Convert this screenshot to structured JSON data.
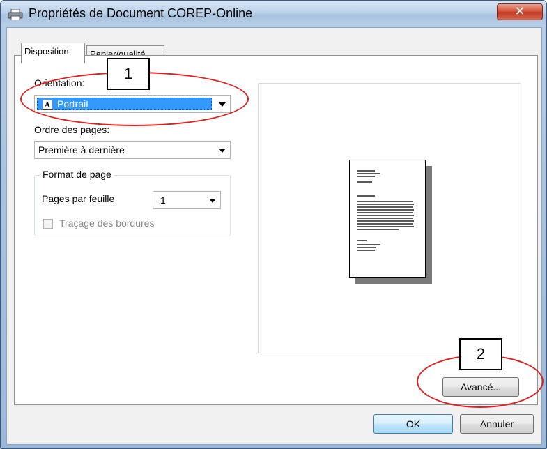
{
  "window": {
    "title": "Propriétés de Document COREP-Online",
    "close_icon": "close-x-icon",
    "title_icon": "printer-icon"
  },
  "tabs": [
    {
      "label": "Disposition",
      "active": true
    },
    {
      "label": "Papier/qualité",
      "active": false
    }
  ],
  "layout": {
    "orientation_label": "Orientation:",
    "orientation_value": "Portrait",
    "orientation_icon": "portrait-A-icon",
    "page_order_label": "Ordre des pages:",
    "page_order_value": "Première à dernière",
    "page_format_group": "Format de page",
    "pages_per_sheet_label": "Pages par feuille",
    "pages_per_sheet_value": "1",
    "borders_label": "Traçage des bordures",
    "borders_checked": false
  },
  "buttons": {
    "advanced": "Avancé...",
    "ok": "OK",
    "cancel": "Annuler"
  },
  "annotations": {
    "callout1": "1",
    "callout2": "2",
    "color": "#e02020"
  }
}
